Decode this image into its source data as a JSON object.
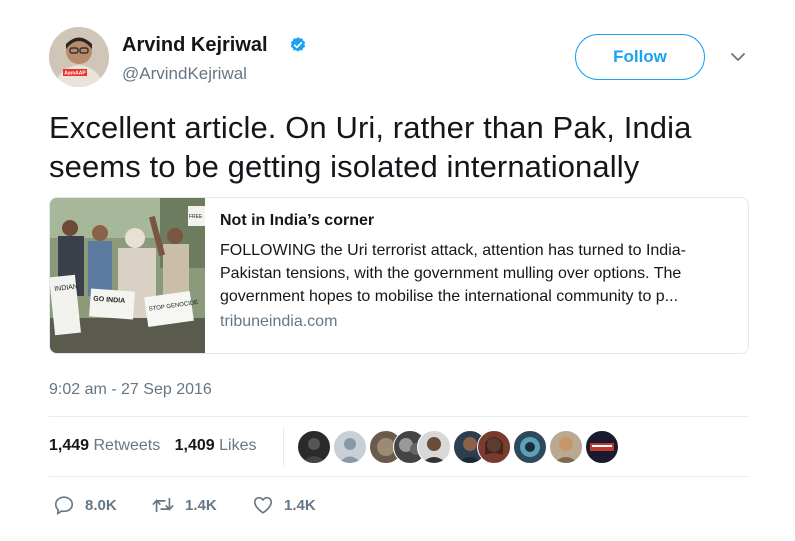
{
  "author": {
    "name": "Arvind Kejriwal",
    "handle": "@ArvindKejriwal",
    "avatar_badge_text": "AamAAP"
  },
  "follow_label": "Follow",
  "tweet_text": "Excellent article. On Uri, rather than Pak, India seems to be getting isolated internationally",
  "card": {
    "title": "Not in India’s corner",
    "description": "FOLLOWING the Uri terrorist attack, attention has turned to India-Pakistan tensions, with the government mulling over options. The government hopes to mobilise the international community to p...",
    "domain": "tribuneindia.com",
    "image_signs": [
      "INDIAN",
      "GO INDIA",
      "STOP GENOCIDE",
      "FREE"
    ]
  },
  "timestamp": "9:02 am - 27 Sep 2016",
  "stats": {
    "retweets_count": "1,449",
    "retweets_label": "Retweets",
    "likes_count": "1,409",
    "likes_label": "Likes"
  },
  "actions": {
    "replies": "8.0K",
    "retweets": "1.4K",
    "likes": "1.4K"
  },
  "colors": {
    "accent": "#1da1f2",
    "verified": "#1da1f2",
    "text": "#14171a",
    "secondary": "#657786",
    "border": "#e1e8ed"
  }
}
